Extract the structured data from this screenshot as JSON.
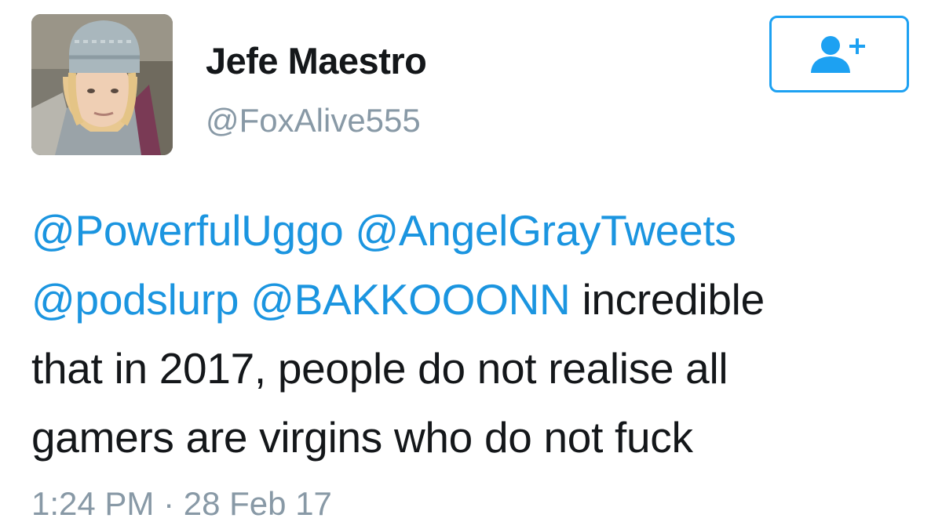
{
  "user": {
    "display_name": "Jefe Maestro",
    "username": "@FoxAlive555"
  },
  "follow_button": {
    "icon": "add-user-icon"
  },
  "tweet": {
    "mentions": [
      "@PowerfulUggo",
      "@AngelGrayTweets",
      "@podslurp",
      "@BAKKOOONN"
    ],
    "text_line_2": "incredible",
    "text_line_3": "that in 2017, people do not realise all",
    "text_line_4": "gamers are virgins who do not fuck",
    "time": "1:24 PM",
    "separator": "·",
    "date": "28 Feb 17"
  },
  "colors": {
    "accent": "#1da1f2",
    "mention": "#1b95e0",
    "secondary_text": "#8899a6",
    "primary_text": "#14171a"
  }
}
